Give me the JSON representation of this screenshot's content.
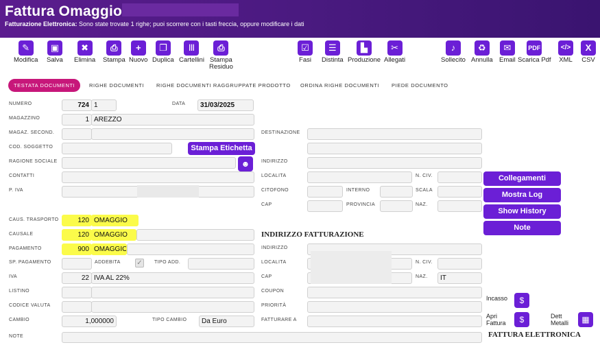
{
  "header": {
    "title": "Fattura Omaggio N.",
    "message_bold": "Fatturazione Elettronica:",
    "message": " Sono state trovate 1 righe; puoi scorrere con i tasti freccia, oppure modificare i dati"
  },
  "toolbar": [
    {
      "id": "modifica",
      "label": "Modifica",
      "icon": "edit-icon",
      "glyph": "✎"
    },
    {
      "id": "salva",
      "label": "Salva",
      "icon": "save-icon",
      "glyph": "▣"
    },
    {
      "id": "elimina",
      "label": "Elimina",
      "icon": "trash-icon",
      "glyph": "🗑"
    },
    {
      "id": "stampa",
      "label": "Stampa",
      "icon": "print-icon",
      "glyph": "⎙"
    },
    {
      "id": "nuovo",
      "label": "Nuovo",
      "icon": "plus-icon",
      "glyph": "+"
    },
    {
      "id": "duplica",
      "label": "Duplica",
      "icon": "copy-icon",
      "glyph": "❐"
    },
    {
      "id": "cartellini",
      "label": "Cartellini",
      "icon": "barcode-icon",
      "glyph": "|||"
    },
    {
      "id": "stampa-residuo",
      "label": "Stampa",
      "label2": "Residuo",
      "icon": "print-icon",
      "glyph": "⎙"
    },
    {
      "id": "fasi",
      "label": "Fasi",
      "icon": "checkbox-icon",
      "glyph": "☑"
    },
    {
      "id": "distinta",
      "label": "Distinta",
      "icon": "list-icon",
      "glyph": "☰"
    },
    {
      "id": "produzione",
      "label": "Produzione",
      "icon": "chart-icon",
      "glyph": "▙"
    },
    {
      "id": "allegati",
      "label": "Allegati",
      "icon": "paperclip-icon",
      "glyph": "🖇"
    },
    {
      "id": "sollecito",
      "label": "Sollecito",
      "icon": "bell-icon",
      "glyph": "🔔"
    },
    {
      "id": "annulla",
      "label": "Annulla",
      "icon": "recycle-icon",
      "glyph": "♻"
    },
    {
      "id": "email",
      "label": "Email",
      "icon": "envelope-icon",
      "glyph": "✉"
    },
    {
      "id": "scarica-pdf",
      "label": "Scarica Pdf",
      "icon": "pdf-icon",
      "glyph": "⬚"
    },
    {
      "id": "xml",
      "label": "XML",
      "icon": "xml-file-icon",
      "glyph": "⟨⟩"
    },
    {
      "id": "csv",
      "label": "CSV",
      "icon": "csv-file-icon",
      "glyph": "X"
    }
  ],
  "tabs": [
    "TESTATA DOCUMENTI",
    "RIGHE DOCUMENTI",
    "RIGHE DOCUMENTI RAGGRUPPATE PRODOTTO",
    "ORDINA RIGHE DOCUMENTI",
    "PIEDE DOCUMENTO"
  ],
  "form": {
    "numero_label": "NUMERO",
    "numero": "724",
    "numero_suffix": "1",
    "data_label": "DATA",
    "data": "31/03/2025",
    "magazzino_label": "MAGAZZINO",
    "magazzino_code": "1",
    "magazzino_name": "AREZZO",
    "magaz_second_label": "MAGAZ. SECOND.",
    "destinazione_label": "DESTINAZIONE",
    "cod_soggetto_label": "COD. SOGGETTO",
    "stampa_etichetta": "Stampa Etichetta",
    "ragione_sociale_label": "RAGIONE SOCIALE",
    "indirizzo_label": "INDIRIZZO",
    "contatti_label": "CONTATTI",
    "localita_label": "LOCALITA",
    "n_civ_label": "N. CIV.",
    "piva_label": "P. IVA",
    "citofono_label": "CITOFONO",
    "interno_label": "INTERNO",
    "scala_label": "SCALA",
    "cap_label": "CAP",
    "provincia_label": "PROVINCIA",
    "naz_label": "NAZ.",
    "caus_trasporto_label": "CAUS. TRASPORTO",
    "caus_trasporto_code": "120",
    "caus_trasporto_name": "OMAGGIO",
    "causale_label": "CAUSALE",
    "causale_code": "120",
    "causale_name": "OMAGGIO",
    "pagamento_label": "PAGAMENTO",
    "pagamento_code": "900",
    "pagamento_name": "OMAGGIO",
    "sp_pagamento_label": "SP. PAGAMENTO",
    "addebita_label": "ADDEBITA",
    "tipo_add_label": "TIPO ADD.",
    "iva_label": "IVA",
    "iva_code": "22",
    "iva_name": "IVA AL 22%",
    "listino_label": "LISTINO",
    "codice_valuta_label": "CODICE VALUTA",
    "cambio_label": "CAMBIO",
    "cambio": "1,000000",
    "tipo_cambio_label": "TIPO CAMBIO",
    "tipo_cambio": "Da Euro",
    "note_label": "NOTE",
    "indirizzo_fatt_heading": "INDIRIZZO FATTURAZIONE",
    "fatt_indirizzo_label": "INDIRIZZO",
    "fatt_localita_label": "LOCALITA",
    "fatt_n_civ_label": "N. CIV.",
    "fatt_cap_label": "CAP",
    "fatt_naz_label": "NAZ.",
    "fatt_naz": "IT",
    "coupon_label": "COUPON",
    "priorita_label": "PRIORITÀ",
    "fatturare_a_label": "FATTURARE A"
  },
  "side_buttons": {
    "collegamenti": "Collegamenti",
    "mostra_log": "Mostra Log",
    "show_history": "Show History",
    "note": "Note"
  },
  "bottom_right": {
    "incasso": "Incasso",
    "apri": "Apri",
    "fattura": "Fattura",
    "dett": "Dett",
    "metalli": "Metalli",
    "fattura_elettronica": "FATTURA ELETTRONICA"
  },
  "colors": {
    "header_bg": "#4a1a80",
    "accent": "#6b1fd6",
    "active_tab": "#c7177a",
    "highlight": "#fbfb4a"
  }
}
